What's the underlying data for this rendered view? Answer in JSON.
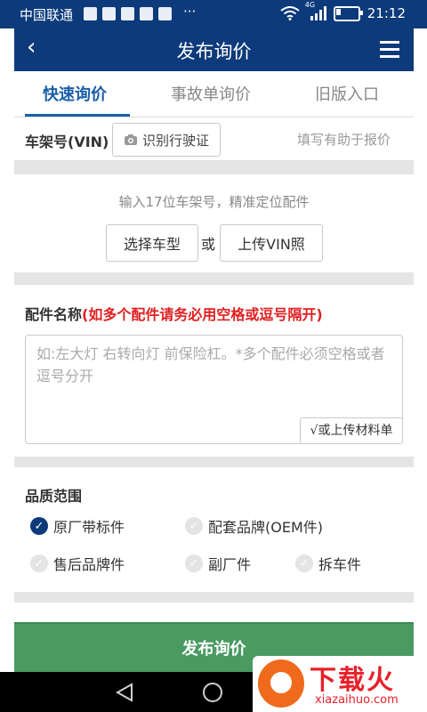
{
  "status_bar": {
    "carrier": "中国联通",
    "overflow": "···",
    "network": "4G",
    "time": "21:12"
  },
  "header": {
    "title": "发布询价",
    "back_icon": "chevron-left-icon",
    "menu_icon": "hamburger-menu-icon"
  },
  "tabs": [
    {
      "label": "快速询价",
      "active": true
    },
    {
      "label": "事故单询价",
      "active": false
    },
    {
      "label": "旧版入口",
      "active": false
    }
  ],
  "vin": {
    "label": "车架号(VIN)",
    "scan_button": "识别行驶证",
    "hint": "填写有助于报价"
  },
  "vin_section": {
    "description": "输入17位车架号，精准定位配件",
    "select_model_button": "选择车型",
    "or_text": "或",
    "upload_vin_button": "上传VIN照"
  },
  "parts": {
    "label": "配件名称",
    "label_note": "(如多个配件请务必用空格或逗号隔开)",
    "placeholder": "如:左大灯 右转向灯 前保险杠。*多个配件必须空格或者逗号分开",
    "upload_button": "√或上传材料单"
  },
  "quality": {
    "title": "品质范围",
    "options": [
      {
        "label": "原厂带标件",
        "checked": true
      },
      {
        "label": "配套品牌(OEM件)",
        "checked": false
      },
      {
        "label": "售后品牌件",
        "checked": false
      },
      {
        "label": "副厂件",
        "checked": false
      },
      {
        "label": "拆车件",
        "checked": false
      }
    ]
  },
  "submit_button": "发布询价",
  "watermark": {
    "title": "下载火",
    "url": "xiazaihuo.com"
  },
  "colors": {
    "primary": "#0d3a7a",
    "accent": "#1b5fa8",
    "submit": "#4a9a62",
    "warning": "#e02020"
  }
}
